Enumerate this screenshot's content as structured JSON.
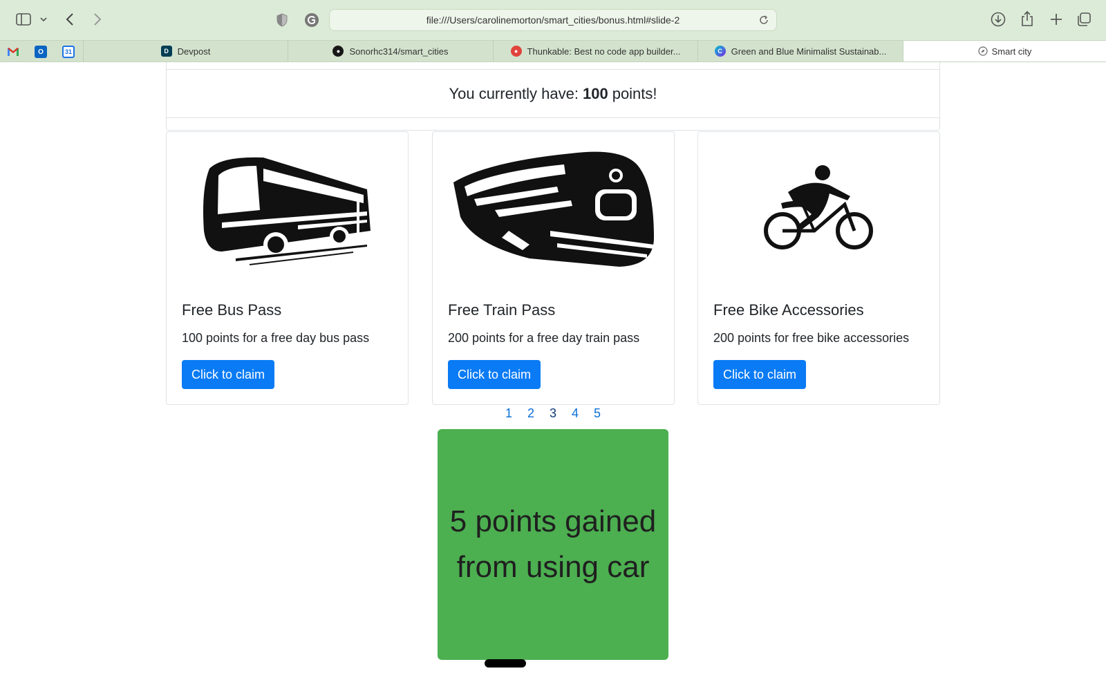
{
  "browser": {
    "url": "file:///Users/carolinemorton/smart_cities/bonus.html#slide-2",
    "tabs": [
      {
        "label": "Devpost",
        "icon": "devpost-icon"
      },
      {
        "label": "Sonorhc314/smart_cities",
        "icon": "github-icon"
      },
      {
        "label": "Thunkable: Best no code app builder...",
        "icon": "thunkable-icon"
      },
      {
        "label": "Green and Blue Minimalist Sustainab...",
        "icon": "canva-icon"
      },
      {
        "label": "Smart city",
        "icon": "compass-icon"
      }
    ],
    "bookmarks": [
      "gmail-icon",
      "outlook-icon",
      "calendar-icon"
    ],
    "calendar_day": "31"
  },
  "points": {
    "prefix": "You currently have:",
    "value": "100",
    "suffix": "points!"
  },
  "rewards": [
    {
      "title": "Free Bus Pass",
      "text": "100 points for a free day bus pass",
      "button": "Click to claim",
      "icon": "bus-icon"
    },
    {
      "title": "Free Train Pass",
      "text": "200 points for a free day train pass",
      "button": "Click to claim",
      "icon": "train-icon"
    },
    {
      "title": "Free Bike Accessories",
      "text": "200 points for free bike accessories",
      "button": "Click to claim",
      "icon": "cyclist-icon"
    }
  ],
  "pagination": [
    "1",
    "2",
    "3",
    "4",
    "5"
  ],
  "current_page": "3",
  "slide": {
    "text": "5 points gained from using car",
    "color": "#4caf50"
  },
  "colors": {
    "accent": "#0a7bf5",
    "chrome": "#dcebd7"
  }
}
